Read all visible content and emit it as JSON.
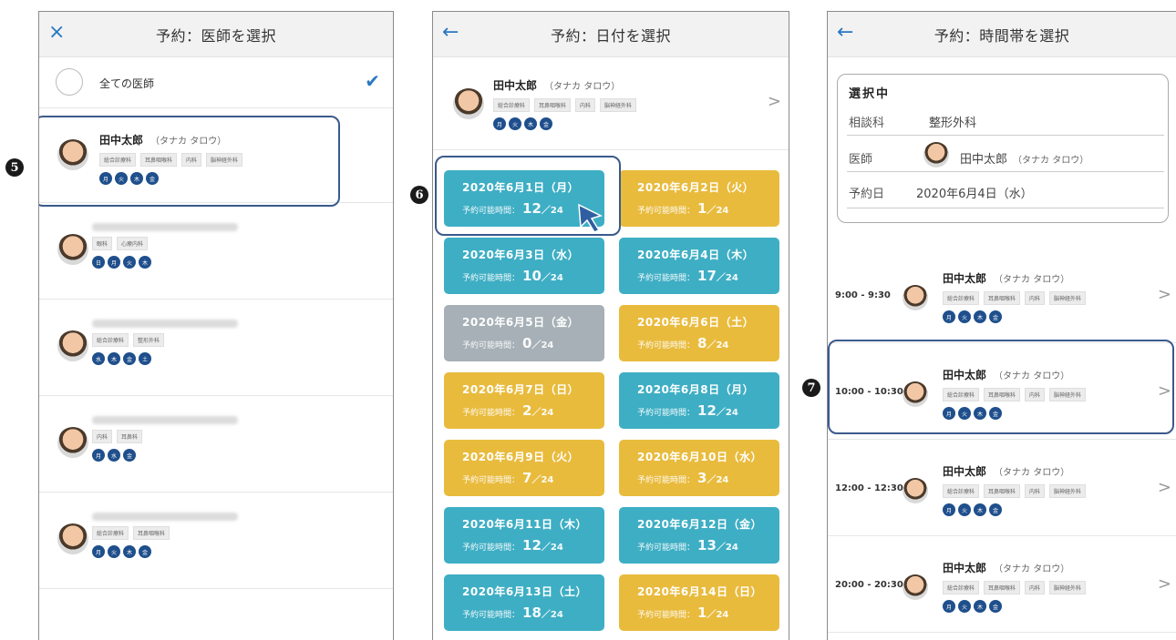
{
  "screen1": {
    "title": "予約：医師を選択",
    "close_icon": "×",
    "all_doctors_label": "全ての医師",
    "check_icon": "✔",
    "featured": {
      "name": "田中太郎",
      "kana": "（タナカ タロウ）",
      "tags": [
        "総合診療科",
        "耳鼻咽喉科",
        "内科",
        "脳神経外科"
      ],
      "days": [
        "月",
        "火",
        "木",
        "金"
      ]
    },
    "doctors": [
      {
        "tags": [
          "眼科",
          "心療内科"
        ],
        "days": [
          "日",
          "月",
          "火",
          "木"
        ]
      },
      {
        "tags": [
          "総合診療科",
          "整形外科"
        ],
        "days": [
          "水",
          "木",
          "金",
          "土"
        ]
      },
      {
        "tags": [
          "内科",
          "耳鼻科"
        ],
        "days": [
          "月",
          "水",
          "金"
        ]
      },
      {
        "tags": [
          "総合診療科",
          "耳鼻咽喉科"
        ],
        "days": [
          "月",
          "火",
          "木",
          "金"
        ]
      }
    ],
    "marker": "5"
  },
  "screen2": {
    "title": "予約：日付を選択",
    "back_icon": "←",
    "doctor": {
      "name": "田中太郎",
      "kana": "（タナカ タロウ）",
      "tags": [
        "総合診療科",
        "耳鼻咽喉科",
        "内科",
        "脳神経外科"
      ],
      "days": [
        "月",
        "火",
        "木",
        "金"
      ]
    },
    "chevron": ">",
    "avail_label": "予約可能時間：",
    "slash_total": "／24",
    "dates": [
      {
        "date": "2020年6月1日（月）",
        "count": "12",
        "color": "#3eaec4"
      },
      {
        "date": "2020年6月2日（火）",
        "count": "1",
        "color": "#e9bb3d"
      },
      {
        "date": "2020年6月3日（水）",
        "count": "10",
        "color": "#3eaec4"
      },
      {
        "date": "2020年6月4日（木）",
        "count": "17",
        "color": "#3eaec4"
      },
      {
        "date": "2020年6月5日（金）",
        "count": "0",
        "color": "#a6b0b6"
      },
      {
        "date": "2020年6月6日（土）",
        "count": "8",
        "color": "#e9bb3d"
      },
      {
        "date": "2020年6月7日（日）",
        "count": "2",
        "color": "#e9bb3d"
      },
      {
        "date": "2020年6月8日（月）",
        "count": "12",
        "color": "#3eaec4"
      },
      {
        "date": "2020年6月9日（火）",
        "count": "7",
        "color": "#e9bb3d"
      },
      {
        "date": "2020年6月10日（水）",
        "count": "3",
        "color": "#e9bb3d"
      },
      {
        "date": "2020年6月11日（木）",
        "count": "12",
        "color": "#3eaec4"
      },
      {
        "date": "2020年6月12日（金）",
        "count": "13",
        "color": "#3eaec4"
      },
      {
        "date": "2020年6月13日（土）",
        "count": "18",
        "color": "#3eaec4"
      },
      {
        "date": "2020年6月14日（日）",
        "count": "1",
        "color": "#e9bb3d"
      }
    ],
    "marker": "6"
  },
  "screen3": {
    "title": "予約：時間帯を選択",
    "back_icon": "←",
    "selected_heading": "選択中",
    "dept_label": "相談科",
    "dept_value": "整形外科",
    "doctor_label": "医師",
    "doctor_value": "田中太郎",
    "doctor_kana": "（タナカ タロウ）",
    "date_label": "予約日",
    "date_value": "2020年6月4日（水）",
    "slots": [
      {
        "time": "9:00 - 9:30"
      },
      {
        "time": "10:00 - 10:30"
      },
      {
        "time": "12:00 - 12:30"
      },
      {
        "time": "20:00 - 20:30"
      }
    ],
    "slot_doctor": {
      "name": "田中太郎",
      "kana": "（タナカ タロウ）",
      "tags": [
        "総合診療科",
        "耳鼻咽喉科",
        "内科",
        "脳神経外科"
      ],
      "days": [
        "月",
        "火",
        "木",
        "金"
      ]
    },
    "chevron": ">",
    "marker": "7"
  },
  "colors": {
    "teal": "#3eaec4",
    "gold": "#e9bb3d",
    "gray": "#a6b0b6",
    "navy_day": "#1f4f8c",
    "accent_blue": "#2a78c2"
  }
}
